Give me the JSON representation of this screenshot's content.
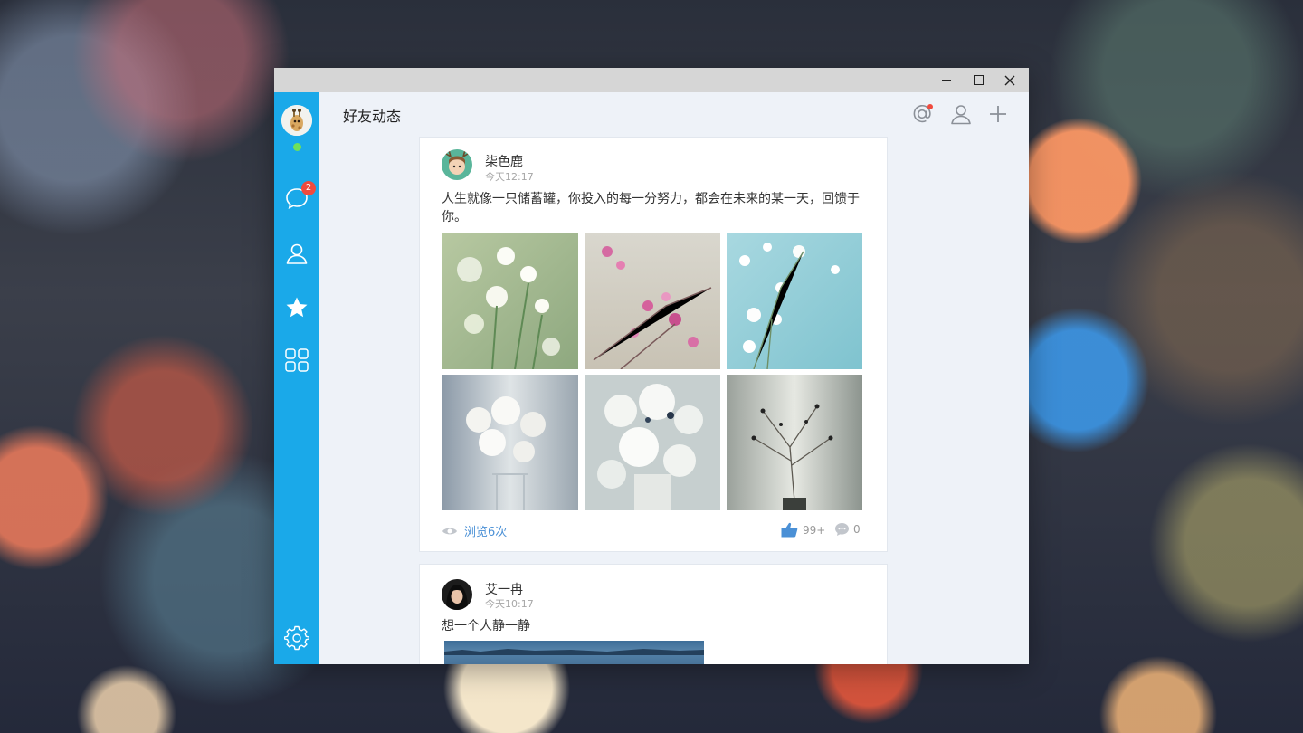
{
  "window": {
    "controls": {
      "minimize": "minimize",
      "maximize": "maximize",
      "close": "close"
    }
  },
  "sidebar": {
    "chat_badge": "2",
    "items": [
      {
        "name": "chat",
        "icon": "chat-bubble-icon",
        "badge": "2"
      },
      {
        "name": "contacts",
        "icon": "person-icon"
      },
      {
        "name": "favorites",
        "icon": "star-icon",
        "active": true
      },
      {
        "name": "apps",
        "icon": "grid-icon"
      },
      {
        "name": "settings",
        "icon": "gear-icon"
      }
    ]
  },
  "header": {
    "title": "好友动态",
    "icons": [
      "at-icon",
      "person-icon",
      "plus-icon"
    ]
  },
  "posts": [
    {
      "author": "柒色鹿",
      "time": "今天12:17",
      "text": "人生就像一只储蓄罐，你投入的每一分努力，都会在未来的某一天，回馈于你。",
      "views": "浏览6次",
      "likes": "99+",
      "comments": "0"
    },
    {
      "author": "艾一冉",
      "time": "今天10:17",
      "text": "想一个人静一静"
    }
  ],
  "colors": {
    "sidebar": "#1aa9e9",
    "accent_link": "#4a90d6",
    "badge": "#f04a3e",
    "online": "#6fe05a",
    "like": "#4a90d6"
  }
}
